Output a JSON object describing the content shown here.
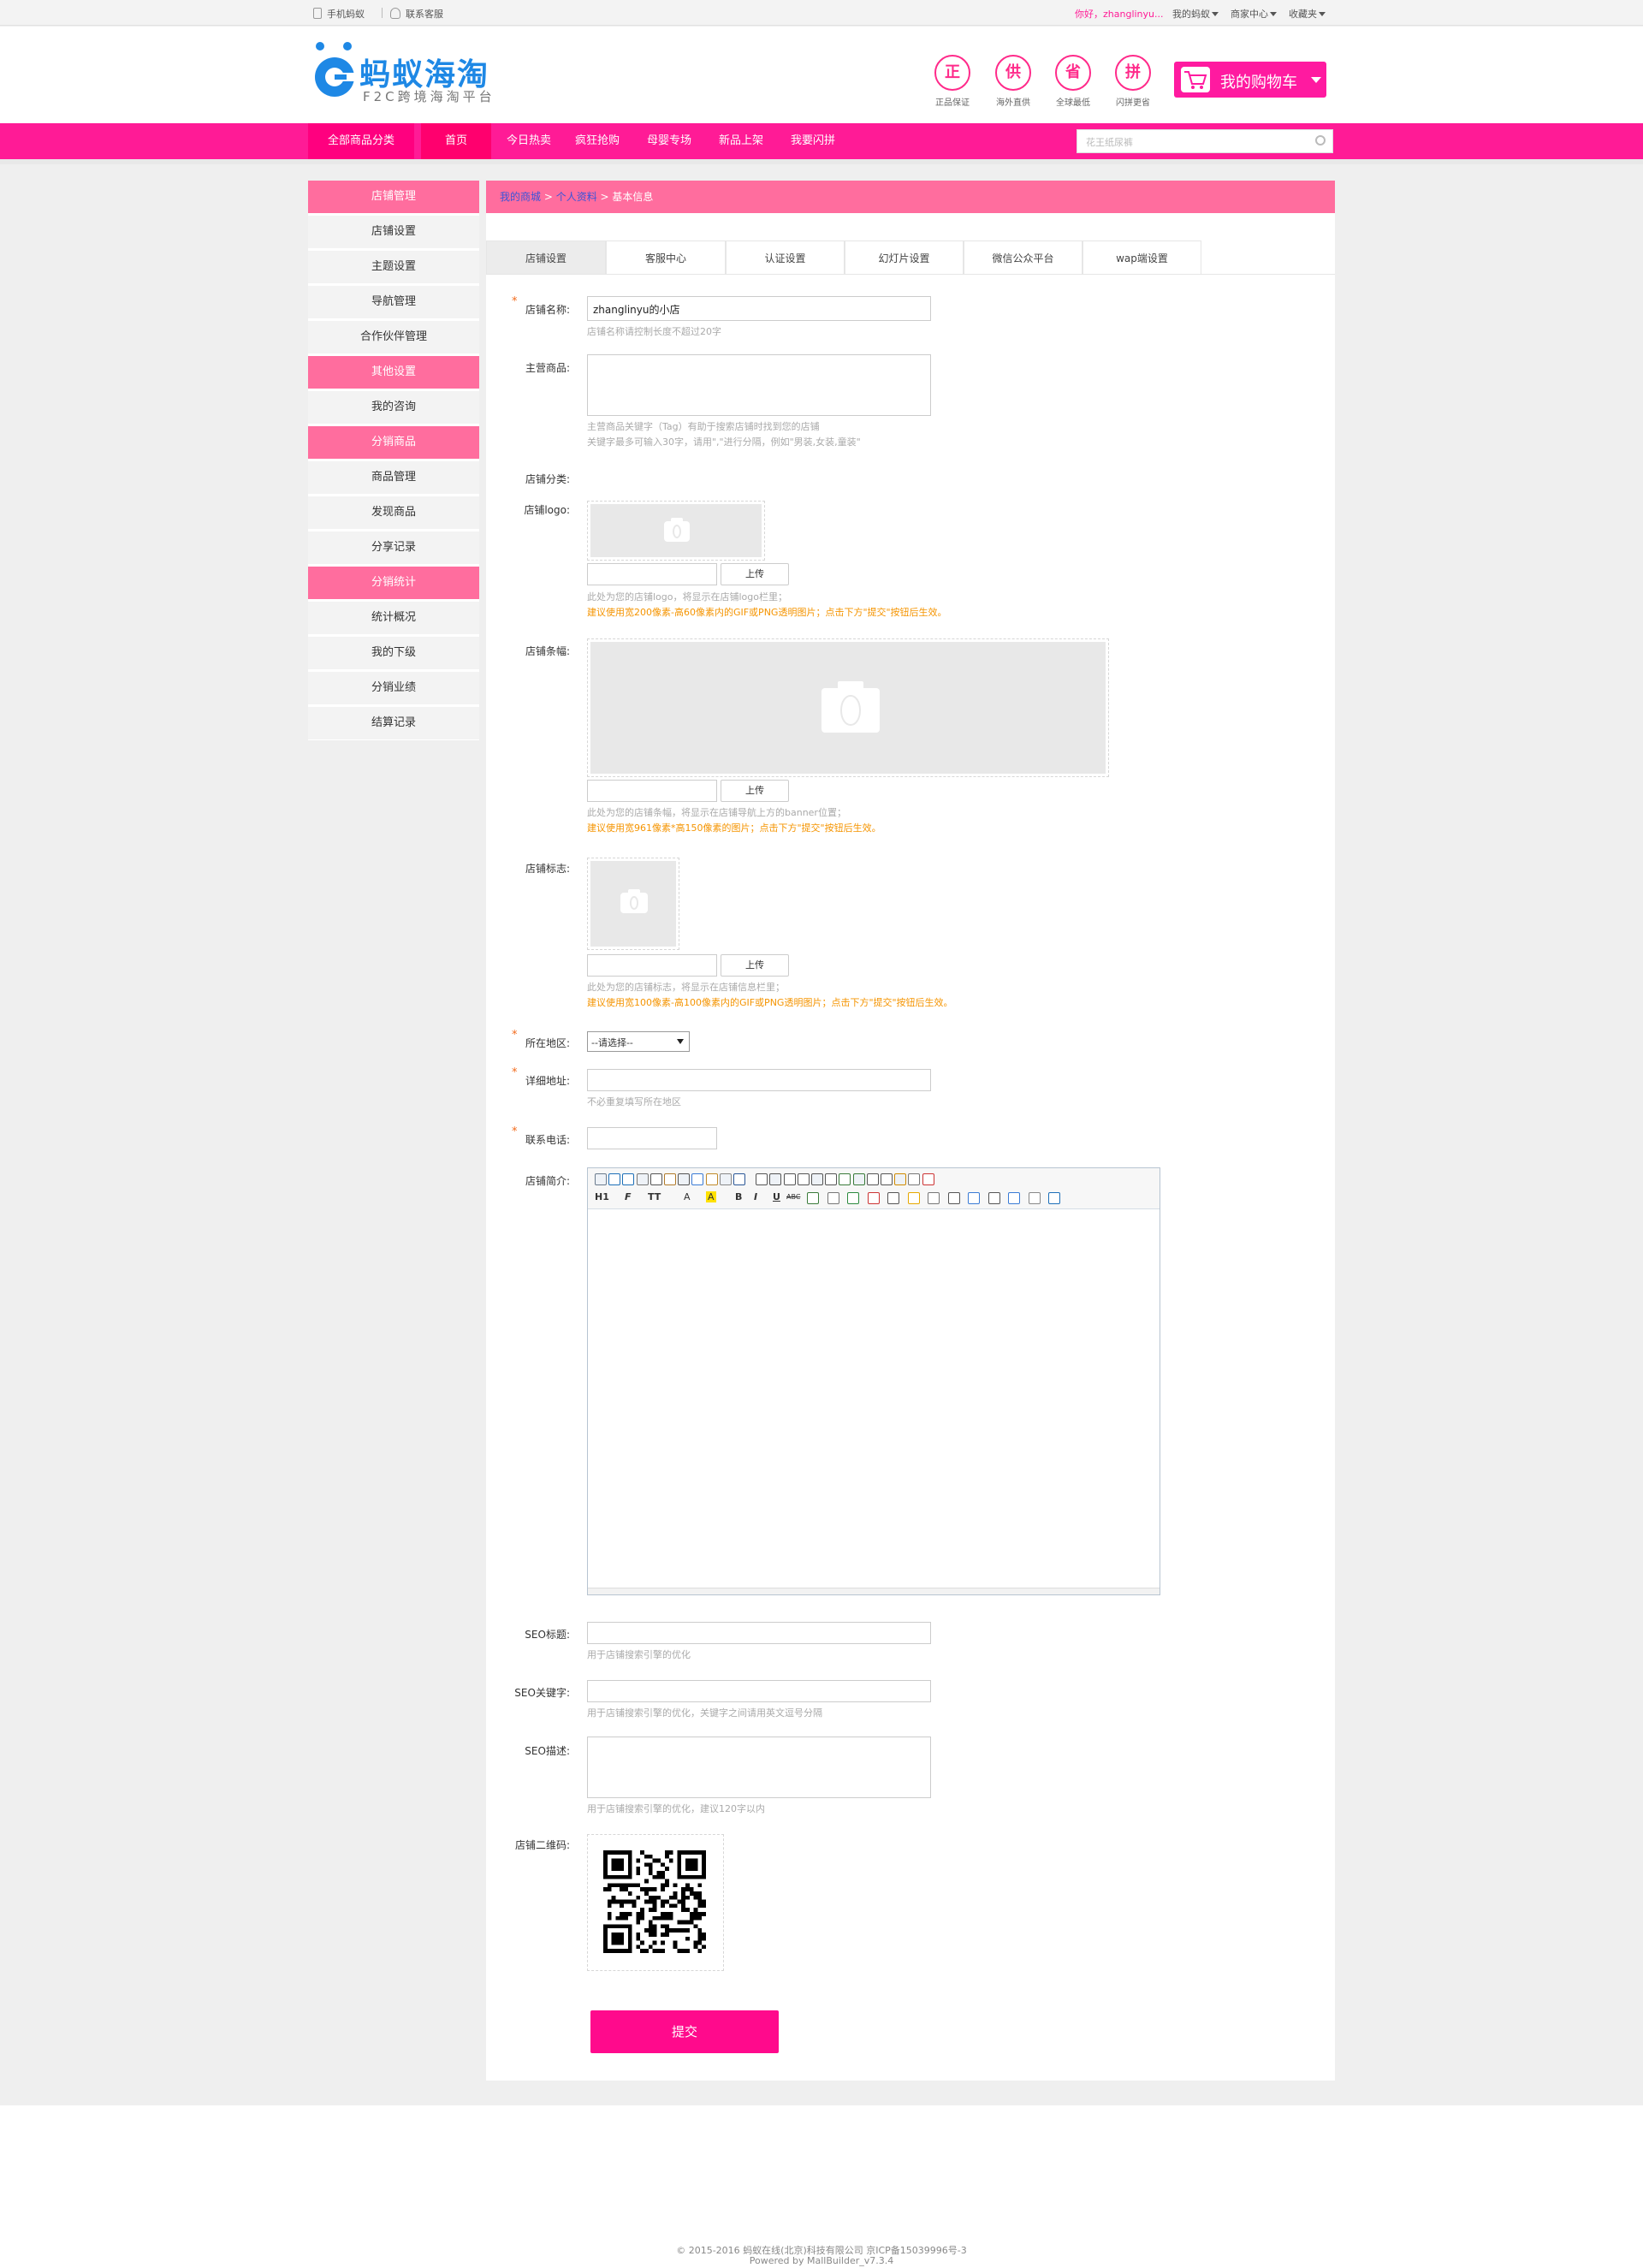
{
  "topbar": {
    "mobile": "手机蚂蚁",
    "service": "联系客服",
    "greeting": "你好，zhanglinyu...",
    "my_ant": "我的蚂蚁",
    "merchant": "商家中心",
    "favorites": "收藏夹"
  },
  "header": {
    "logo_title": "蚂蚁海淘",
    "logo_sub": "F2C跨境海淘平台",
    "badges": [
      {
        "char": "正",
        "label": "正品保证"
      },
      {
        "char": "供",
        "label": "海外直供"
      },
      {
        "char": "省",
        "label": "全球最低"
      },
      {
        "char": "拼",
        "label": "闪拼更省"
      }
    ],
    "cart": "我的购物车"
  },
  "nav": {
    "all_categories": "全部商品分类",
    "items": [
      "首页",
      "今日热卖",
      "疯狂抢购",
      "母婴专场",
      "新品上架",
      "我要闪拼"
    ],
    "search_placeholder": "花王纸尿裤"
  },
  "sidebar": [
    {
      "type": "head",
      "label": "店铺管理"
    },
    {
      "type": "item",
      "label": "店铺设置"
    },
    {
      "type": "item",
      "label": "主题设置"
    },
    {
      "type": "item",
      "label": "导航管理"
    },
    {
      "type": "item",
      "label": "合作伙伴管理"
    },
    {
      "type": "head",
      "label": "其他设置"
    },
    {
      "type": "item",
      "label": "我的咨询"
    },
    {
      "type": "head",
      "label": "分销商品"
    },
    {
      "type": "item",
      "label": "商品管理"
    },
    {
      "type": "item",
      "label": "发现商品"
    },
    {
      "type": "item",
      "label": "分享记录"
    },
    {
      "type": "head",
      "label": "分销统计"
    },
    {
      "type": "item",
      "label": "统计概况"
    },
    {
      "type": "item",
      "label": "我的下级"
    },
    {
      "type": "item",
      "label": "分销业绩"
    },
    {
      "type": "item",
      "label": "结算记录"
    }
  ],
  "breadcrumb": {
    "a1": "我的商城",
    "sep": " > ",
    "a2": "个人资料",
    "current": "基本信息"
  },
  "tabs": [
    "店铺设置",
    "客服中心",
    "认证设置",
    "幻灯片设置",
    "微信公众平台",
    "wap端设置"
  ],
  "form": {
    "shop_name": {
      "label": "店铺名称:",
      "value": "zhanglinyu的小店",
      "help": "店铺名称请控制长度不超过20字"
    },
    "main_goods": {
      "label": "主营商品:",
      "help1": "主营商品关键字（Tag）有助于搜索店铺时找到您的店铺",
      "help2": "关键字最多可输入30字，请用\",\"进行分隔，例如\"男装,女装,童装\""
    },
    "category": {
      "label": "店铺分类:"
    },
    "logo": {
      "label": "店铺logo:",
      "upload": "上传",
      "help": "此处为您的店铺logo，将显示在店铺logo栏里；",
      "warn": "建议使用宽200像素-高60像素内的GIF或PNG透明图片；点击下方\"提交\"按钮后生效。"
    },
    "banner": {
      "label": "店铺条幅:",
      "upload": "上传",
      "help": "此处为您的店铺条幅，将显示在店铺导航上方的banner位置；",
      "warn": "建议使用宽961像素*高150像素的图片；点击下方\"提交\"按钮后生效。"
    },
    "sign": {
      "label": "店铺标志:",
      "upload": "上传",
      "help": "此处为您的店铺标志，将显示在店铺信息栏里；",
      "warn": "建议使用宽100像素-高100像素内的GIF或PNG透明图片；点击下方\"提交\"按钮后生效。"
    },
    "region": {
      "label": "所在地区:",
      "value": "--请选择--"
    },
    "address": {
      "label": "详细地址:",
      "help": "不必重复填写所在地区"
    },
    "phone": {
      "label": "联系电话:"
    },
    "intro": {
      "label": "店铺简介:"
    },
    "seo_title": {
      "label": "SEO标题:",
      "help": "用于店铺搜索引擎的优化"
    },
    "seo_keywords": {
      "label": "SEO关键字:",
      "help": "用于店铺搜索引擎的优化，关键字之间请用英文逗号分隔"
    },
    "seo_desc": {
      "label": "SEO描述:",
      "help": "用于店铺搜索引擎的优化，建议120字以内"
    },
    "qrcode": {
      "label": "店铺二维码:"
    },
    "submit": "提交"
  },
  "editor": {
    "row2": [
      "H1",
      "F",
      "TT",
      "A",
      "A",
      "B",
      "I",
      "U",
      "ABC"
    ]
  },
  "footer": {
    "line1": "© 2015-2016 蚂蚁在线(北京)科技有限公司 京ICP备15039996号-3",
    "line2": "Powered by MallBuilder_v7.3.4"
  },
  "colors": {
    "primary": "#ff1b96",
    "sidebar_head": "#ff6d9e",
    "submit": "#ff0a8c",
    "warn": "#f59400"
  }
}
